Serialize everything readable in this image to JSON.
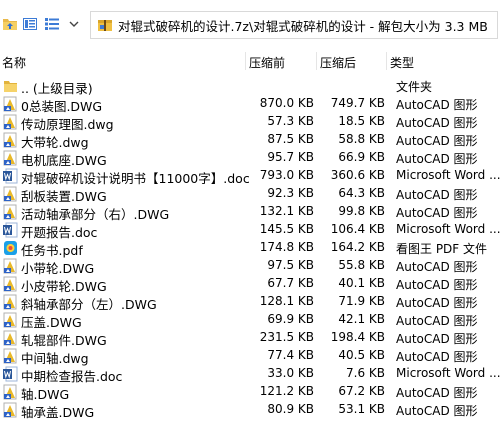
{
  "address": {
    "path": "对辊式破碎机的设计.7z\\对辊式破碎机的设计 - 解包大小为 3.3 MB"
  },
  "columns": {
    "name": "名称",
    "packed": "压缩前",
    "compressed": "压缩后",
    "type": "类型"
  },
  "files": [
    {
      "name": ".. (上级目录)",
      "before": "",
      "after": "",
      "type": "文件夹",
      "icon": "folder-icon"
    },
    {
      "name": "0总装图.DWG",
      "before": "870.0 KB",
      "after": "749.7 KB",
      "type": "AutoCAD 图形",
      "icon": "autocad-icon"
    },
    {
      "name": "传动原理图.dwg",
      "before": "57.3 KB",
      "after": "18.5 KB",
      "type": "AutoCAD 图形",
      "icon": "autocad-icon"
    },
    {
      "name": "大带轮.dwg",
      "before": "87.5 KB",
      "after": "58.8 KB",
      "type": "AutoCAD 图形",
      "icon": "autocad-icon"
    },
    {
      "name": "电机底座.DWG",
      "before": "95.7 KB",
      "after": "66.9 KB",
      "type": "AutoCAD 图形",
      "icon": "autocad-icon"
    },
    {
      "name": "对辊破碎机设计说明书【11000字】.doc",
      "before": "793.0 KB",
      "after": "360.6 KB",
      "type": "Microsoft Word ...",
      "icon": "word-icon"
    },
    {
      "name": "刮板装置.DWG",
      "before": "92.3 KB",
      "after": "64.3 KB",
      "type": "AutoCAD 图形",
      "icon": "autocad-icon"
    },
    {
      "name": "活动轴承部分（右）.DWG",
      "before": "132.1 KB",
      "after": "99.8 KB",
      "type": "AutoCAD 图形",
      "icon": "autocad-icon"
    },
    {
      "name": "开题报告.doc",
      "before": "145.5 KB",
      "after": "106.4 KB",
      "type": "Microsoft Word ...",
      "icon": "word-icon"
    },
    {
      "name": "任务书.pdf",
      "before": "174.8 KB",
      "after": "164.2 KB",
      "type": "看图王 PDF 文件",
      "icon": "pdf-icon"
    },
    {
      "name": "小带轮.DWG",
      "before": "97.5 KB",
      "after": "55.8 KB",
      "type": "AutoCAD 图形",
      "icon": "autocad-icon"
    },
    {
      "name": "小皮带轮.DWG",
      "before": "67.7 KB",
      "after": "40.1 KB",
      "type": "AutoCAD 图形",
      "icon": "autocad-icon"
    },
    {
      "name": "斜轴承部分（左）.DWG",
      "before": "128.1 KB",
      "after": "71.9 KB",
      "type": "AutoCAD 图形",
      "icon": "autocad-icon"
    },
    {
      "name": "压盖.DWG",
      "before": "69.9 KB",
      "after": "42.1 KB",
      "type": "AutoCAD 图形",
      "icon": "autocad-icon"
    },
    {
      "name": "轧辊部件.DWG",
      "before": "231.5 KB",
      "after": "198.4 KB",
      "type": "AutoCAD 图形",
      "icon": "autocad-icon"
    },
    {
      "name": "中间轴.dwg",
      "before": "77.4 KB",
      "after": "40.5 KB",
      "type": "AutoCAD 图形",
      "icon": "autocad-icon"
    },
    {
      "name": "中期检查报告.doc",
      "before": "33.0 KB",
      "after": "7.6 KB",
      "type": "Microsoft Word ...",
      "icon": "word-icon"
    },
    {
      "name": "轴.DWG",
      "before": "121.2 KB",
      "after": "67.2 KB",
      "type": "AutoCAD 图形",
      "icon": "autocad-icon"
    },
    {
      "name": "轴承盖.DWG",
      "before": "80.9 KB",
      "after": "53.1 KB",
      "type": "AutoCAD 图形",
      "icon": "autocad-icon"
    }
  ]
}
